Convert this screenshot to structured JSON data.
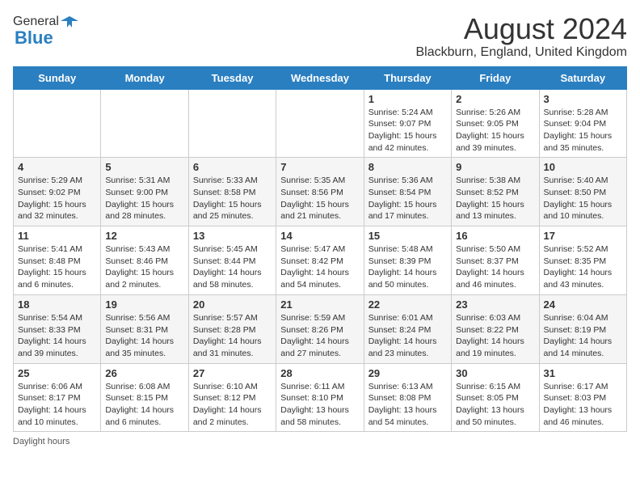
{
  "logo": {
    "general": "General",
    "blue": "Blue"
  },
  "title": {
    "month_year": "August 2024",
    "location": "Blackburn, England, United Kingdom"
  },
  "days_of_week": [
    "Sunday",
    "Monday",
    "Tuesday",
    "Wednesday",
    "Thursday",
    "Friday",
    "Saturday"
  ],
  "footer": {
    "daylight_label": "Daylight hours"
  },
  "weeks": [
    [
      {
        "day": "",
        "info": ""
      },
      {
        "day": "",
        "info": ""
      },
      {
        "day": "",
        "info": ""
      },
      {
        "day": "",
        "info": ""
      },
      {
        "day": "1",
        "info": "Sunrise: 5:24 AM\nSunset: 9:07 PM\nDaylight: 15 hours\nand 42 minutes."
      },
      {
        "day": "2",
        "info": "Sunrise: 5:26 AM\nSunset: 9:05 PM\nDaylight: 15 hours\nand 39 minutes."
      },
      {
        "day": "3",
        "info": "Sunrise: 5:28 AM\nSunset: 9:04 PM\nDaylight: 15 hours\nand 35 minutes."
      }
    ],
    [
      {
        "day": "4",
        "info": "Sunrise: 5:29 AM\nSunset: 9:02 PM\nDaylight: 15 hours\nand 32 minutes."
      },
      {
        "day": "5",
        "info": "Sunrise: 5:31 AM\nSunset: 9:00 PM\nDaylight: 15 hours\nand 28 minutes."
      },
      {
        "day": "6",
        "info": "Sunrise: 5:33 AM\nSunset: 8:58 PM\nDaylight: 15 hours\nand 25 minutes."
      },
      {
        "day": "7",
        "info": "Sunrise: 5:35 AM\nSunset: 8:56 PM\nDaylight: 15 hours\nand 21 minutes."
      },
      {
        "day": "8",
        "info": "Sunrise: 5:36 AM\nSunset: 8:54 PM\nDaylight: 15 hours\nand 17 minutes."
      },
      {
        "day": "9",
        "info": "Sunrise: 5:38 AM\nSunset: 8:52 PM\nDaylight: 15 hours\nand 13 minutes."
      },
      {
        "day": "10",
        "info": "Sunrise: 5:40 AM\nSunset: 8:50 PM\nDaylight: 15 hours\nand 10 minutes."
      }
    ],
    [
      {
        "day": "11",
        "info": "Sunrise: 5:41 AM\nSunset: 8:48 PM\nDaylight: 15 hours\nand 6 minutes."
      },
      {
        "day": "12",
        "info": "Sunrise: 5:43 AM\nSunset: 8:46 PM\nDaylight: 15 hours\nand 2 minutes."
      },
      {
        "day": "13",
        "info": "Sunrise: 5:45 AM\nSunset: 8:44 PM\nDaylight: 14 hours\nand 58 minutes."
      },
      {
        "day": "14",
        "info": "Sunrise: 5:47 AM\nSunset: 8:42 PM\nDaylight: 14 hours\nand 54 minutes."
      },
      {
        "day": "15",
        "info": "Sunrise: 5:48 AM\nSunset: 8:39 PM\nDaylight: 14 hours\nand 50 minutes."
      },
      {
        "day": "16",
        "info": "Sunrise: 5:50 AM\nSunset: 8:37 PM\nDaylight: 14 hours\nand 46 minutes."
      },
      {
        "day": "17",
        "info": "Sunrise: 5:52 AM\nSunset: 8:35 PM\nDaylight: 14 hours\nand 43 minutes."
      }
    ],
    [
      {
        "day": "18",
        "info": "Sunrise: 5:54 AM\nSunset: 8:33 PM\nDaylight: 14 hours\nand 39 minutes."
      },
      {
        "day": "19",
        "info": "Sunrise: 5:56 AM\nSunset: 8:31 PM\nDaylight: 14 hours\nand 35 minutes."
      },
      {
        "day": "20",
        "info": "Sunrise: 5:57 AM\nSunset: 8:28 PM\nDaylight: 14 hours\nand 31 minutes."
      },
      {
        "day": "21",
        "info": "Sunrise: 5:59 AM\nSunset: 8:26 PM\nDaylight: 14 hours\nand 27 minutes."
      },
      {
        "day": "22",
        "info": "Sunrise: 6:01 AM\nSunset: 8:24 PM\nDaylight: 14 hours\nand 23 minutes."
      },
      {
        "day": "23",
        "info": "Sunrise: 6:03 AM\nSunset: 8:22 PM\nDaylight: 14 hours\nand 19 minutes."
      },
      {
        "day": "24",
        "info": "Sunrise: 6:04 AM\nSunset: 8:19 PM\nDaylight: 14 hours\nand 14 minutes."
      }
    ],
    [
      {
        "day": "25",
        "info": "Sunrise: 6:06 AM\nSunset: 8:17 PM\nDaylight: 14 hours\nand 10 minutes."
      },
      {
        "day": "26",
        "info": "Sunrise: 6:08 AM\nSunset: 8:15 PM\nDaylight: 14 hours\nand 6 minutes."
      },
      {
        "day": "27",
        "info": "Sunrise: 6:10 AM\nSunset: 8:12 PM\nDaylight: 14 hours\nand 2 minutes."
      },
      {
        "day": "28",
        "info": "Sunrise: 6:11 AM\nSunset: 8:10 PM\nDaylight: 13 hours\nand 58 minutes."
      },
      {
        "day": "29",
        "info": "Sunrise: 6:13 AM\nSunset: 8:08 PM\nDaylight: 13 hours\nand 54 minutes."
      },
      {
        "day": "30",
        "info": "Sunrise: 6:15 AM\nSunset: 8:05 PM\nDaylight: 13 hours\nand 50 minutes."
      },
      {
        "day": "31",
        "info": "Sunrise: 6:17 AM\nSunset: 8:03 PM\nDaylight: 13 hours\nand 46 minutes."
      }
    ]
  ]
}
